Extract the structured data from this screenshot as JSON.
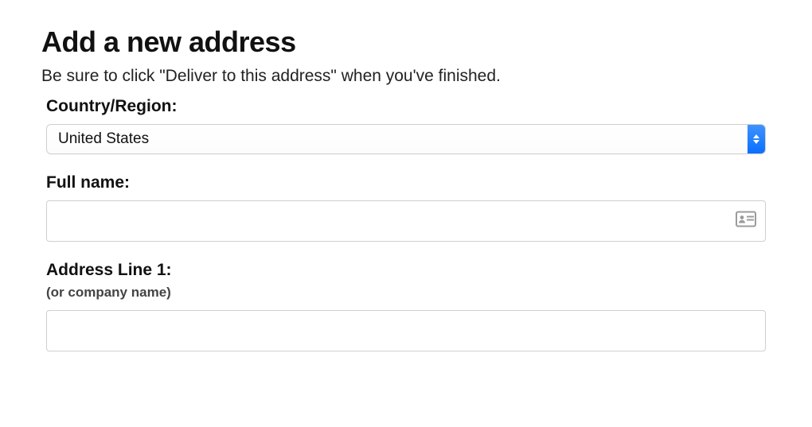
{
  "page": {
    "title": "Add a new address",
    "subtitle": "Be sure to click \"Deliver to this address\" when you've finished."
  },
  "form": {
    "country": {
      "label": "Country/Region:",
      "value": "United States"
    },
    "fullname": {
      "label": "Full name:",
      "value": ""
    },
    "address1": {
      "label": "Address Line 1:",
      "sublabel": "(or company name)",
      "value": ""
    }
  }
}
